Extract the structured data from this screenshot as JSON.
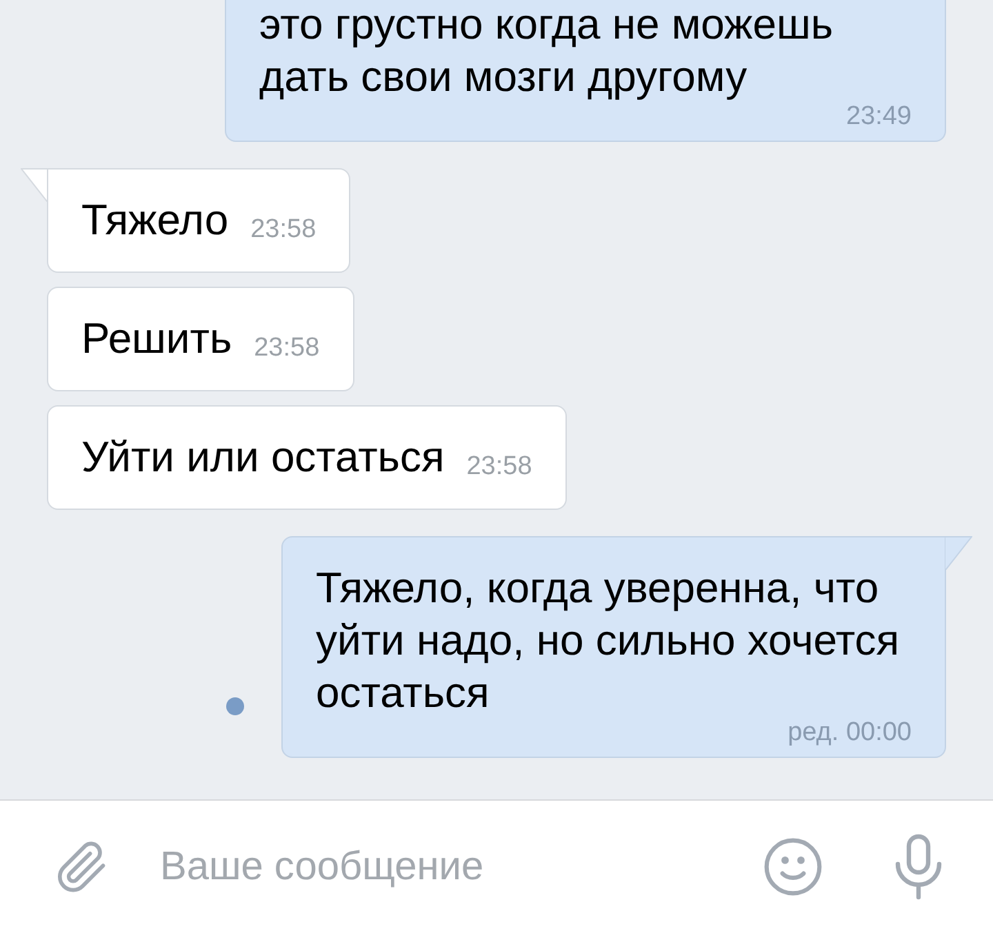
{
  "messages": [
    {
      "kind": "outgoing",
      "text": "это грустно когда не можешь дать свои мозги другому",
      "time": "23:49",
      "tail": false,
      "unread": false
    },
    {
      "kind": "incoming",
      "text": "Тяжело",
      "time": "23:58",
      "tail": true,
      "unread": false
    },
    {
      "kind": "incoming",
      "text": "Решить",
      "time": "23:58",
      "tail": false,
      "unread": false
    },
    {
      "kind": "incoming",
      "text": "Уйти или остаться",
      "time": "23:58",
      "tail": false,
      "unread": false
    },
    {
      "kind": "outgoing",
      "text": "Тяжело, когда уверенна, что уйти надо, но сильно хочется остаться",
      "time": "ред. 00:00",
      "tail": true,
      "unread": true
    }
  ],
  "composer": {
    "placeholder": "Ваше сообщение"
  }
}
